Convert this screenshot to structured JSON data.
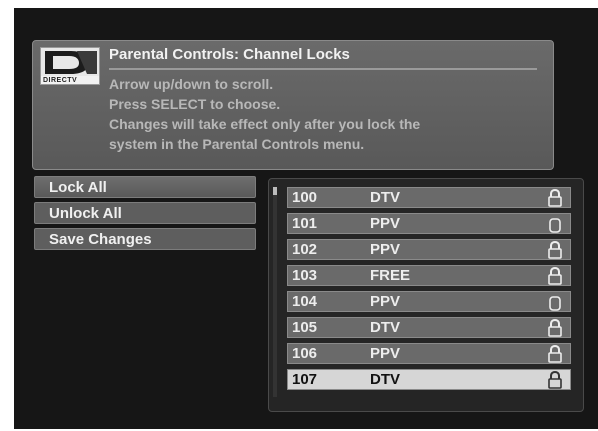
{
  "bleed_chars": [
    "y",
    "I",
    "k",
    "e",
    "e"
  ],
  "header": {
    "logo_text": "DIRECTV",
    "title": "Parental Controls: Channel Locks",
    "instructions": [
      "Arrow up/down to scroll.",
      "Press SELECT to choose.",
      "Changes will take effect only after you lock the",
      "system in the Parental Controls menu."
    ]
  },
  "menu": {
    "items": [
      {
        "label": "Lock All"
      },
      {
        "label": "Unlock All"
      },
      {
        "label": "Save Changes"
      }
    ]
  },
  "channels": [
    {
      "number": "100",
      "network": "DTV",
      "locked": true
    },
    {
      "number": "101",
      "network": "PPV",
      "locked": false
    },
    {
      "number": "102",
      "network": "PPV",
      "locked": true
    },
    {
      "number": "103",
      "network": "FREE",
      "locked": true
    },
    {
      "number": "104",
      "network": "PPV",
      "locked": false
    },
    {
      "number": "105",
      "network": "DTV",
      "locked": true
    },
    {
      "number": "106",
      "network": "PPV",
      "locked": true
    },
    {
      "number": "107",
      "network": "DTV",
      "locked": true,
      "selected": true
    }
  ]
}
